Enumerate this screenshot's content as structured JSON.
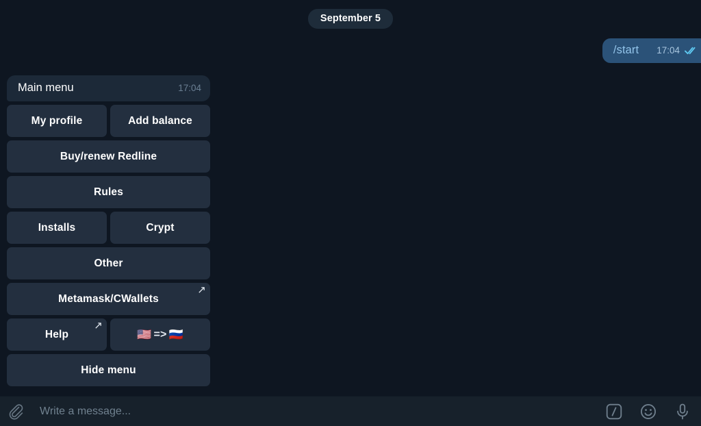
{
  "chat": {
    "date_separator": "September 5",
    "outgoing_message": {
      "text": "/start",
      "time": "17:04",
      "status_icon": "double-check-icon"
    },
    "incoming_message": {
      "text": "Main menu",
      "time": "17:04"
    }
  },
  "keyboard": {
    "rows": [
      [
        {
          "label": "My profile",
          "external": false
        },
        {
          "label": "Add balance",
          "external": false
        }
      ],
      [
        {
          "label": "Buy/renew Redline",
          "external": false
        }
      ],
      [
        {
          "label": "Rules",
          "external": false
        }
      ],
      [
        {
          "label": "Installs",
          "external": false
        },
        {
          "label": "Crypt",
          "external": false
        }
      ],
      [
        {
          "label": "Other",
          "external": false
        }
      ],
      [
        {
          "label": "Metamask/CWallets",
          "external": true
        }
      ],
      [
        {
          "label": "Help",
          "external": true
        },
        {
          "label": "🇺🇸 => 🇷🇺",
          "external": false,
          "flag_from": "🇺🇸",
          "flag_arrow": "=>",
          "flag_to": "🇷🇺"
        }
      ],
      [
        {
          "label": "Hide menu",
          "external": false
        }
      ]
    ],
    "external_link_glyph": "↗"
  },
  "composer": {
    "placeholder": "Write a message...",
    "attach_icon": "paperclip-icon",
    "command_icon": "slash-command-icon",
    "command_glyph": "/",
    "emoji_icon": "smiley-icon",
    "mic_icon": "microphone-icon"
  },
  "colors": {
    "background": "#0e1621",
    "bubble_in": "#1c2938",
    "bubble_out": "#2b5278",
    "keyboard_button": "#232f3f",
    "date_pill": "#1e2c3a",
    "composer_bar": "#17212b",
    "link_text": "#93c4ea",
    "check_blue": "#5ec8f0"
  }
}
